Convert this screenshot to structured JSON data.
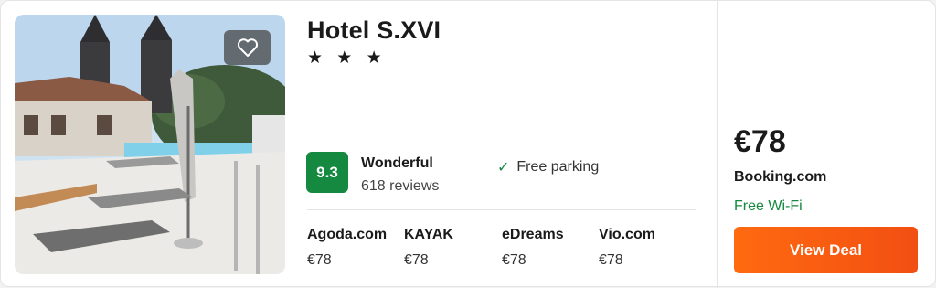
{
  "hotel": {
    "name": "Hotel S.XVI",
    "stars": 3,
    "stars_text": "★ ★ ★",
    "rating_score": "9.3",
    "rating_label": "Wonderful",
    "reviews": "618 reviews",
    "amenity": "Free parking",
    "favorite_icon": "heart-outline-icon"
  },
  "other_offers": [
    {
      "site": "Agoda.com",
      "price": "€78"
    },
    {
      "site": "KAYAK",
      "price": "€78"
    },
    {
      "site": "eDreams",
      "price": "€78"
    },
    {
      "site": "Vio.com",
      "price": "€78"
    }
  ],
  "best_deal": {
    "price": "€78",
    "provider": "Booking.com",
    "perk": "Free Wi-Fi",
    "button_label": "View Deal"
  },
  "colors": {
    "rating_badge": "#168940",
    "perk_text": "#168940",
    "deal_button": "#f24f12"
  }
}
